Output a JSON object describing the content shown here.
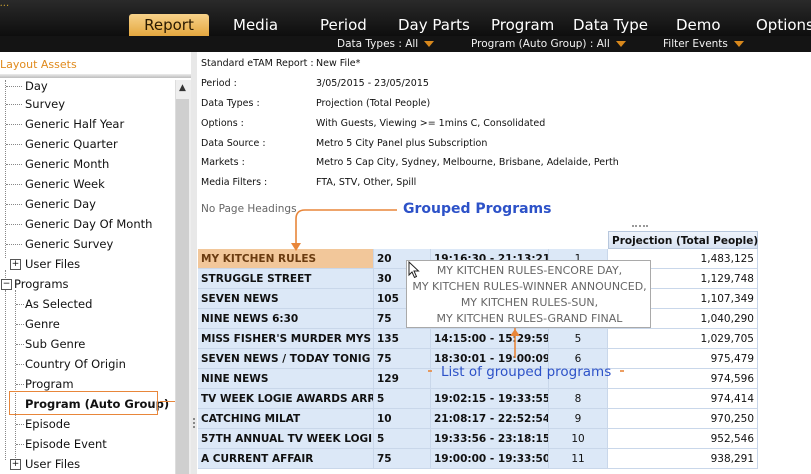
{
  "menu": {
    "brand": "...",
    "items": [
      {
        "label": "Report",
        "active": true
      },
      {
        "label": "Media"
      },
      {
        "label": "Period"
      },
      {
        "label": "Day Parts"
      },
      {
        "label": "Program"
      },
      {
        "label": "Data Type"
      },
      {
        "label": "Demo"
      },
      {
        "label": "Options"
      }
    ]
  },
  "subbar": {
    "data_types": "Data Types : All",
    "program": "Program (Auto Group) : All",
    "filter": "Filter Events"
  },
  "left_panel": {
    "title": "Layout Assets",
    "items": [
      {
        "label": "Day"
      },
      {
        "label": "Survey"
      },
      {
        "label": "Generic Half Year"
      },
      {
        "label": "Generic Quarter"
      },
      {
        "label": "Generic Month"
      },
      {
        "label": "Generic Week"
      },
      {
        "label": "Generic Day"
      },
      {
        "label": "Generic Day Of Month"
      },
      {
        "label": "Generic Survey"
      },
      {
        "label": "User Files"
      },
      {
        "label": "Programs"
      },
      {
        "label": "As Selected"
      },
      {
        "label": "Genre"
      },
      {
        "label": "Sub Genre"
      },
      {
        "label": "Country Of Origin"
      },
      {
        "label": "Program"
      },
      {
        "label": "Program (Auto Group)"
      },
      {
        "label": "Episode"
      },
      {
        "label": "Episode Event"
      },
      {
        "label": "User Files"
      }
    ]
  },
  "report_info": [
    {
      "label": "Standard eTAM Report :",
      "value": "New File*"
    },
    {
      "label": "Period :",
      "value": "3/05/2015 - 23/05/2015"
    },
    {
      "label": "Data Types :",
      "value": "Projection (Total People)"
    },
    {
      "label": "Options :",
      "value": "With Guests, Viewing >= 1mins C, Consolidated"
    },
    {
      "label": "Data Source :",
      "value": "Metro 5 City Panel plus Subscription"
    },
    {
      "label": "Markets :",
      "value": "Metro 5 Cap City, Sydney, Melbourne, Brisbane, Adelaide, Perth"
    },
    {
      "label": "Media Filters :",
      "value": "FTA, STV, Other, Spill"
    }
  ],
  "no_page_headings": "No Page Headings",
  "grid": {
    "projection_header": "Projection (Total People)",
    "rows": [
      {
        "program": "MY KITCHEN RULES",
        "num": "20",
        "time": "19:16:30 - 21:13:21",
        "ep": "1",
        "proj": "1,483,125"
      },
      {
        "program": "STRUGGLE STREET",
        "num": "30",
        "time": "",
        "ep": "",
        "proj": "1,129,748"
      },
      {
        "program": "SEVEN NEWS",
        "num": "105",
        "time": "",
        "ep": "",
        "proj": "1,107,349"
      },
      {
        "program": "NINE NEWS 6:30",
        "num": "75",
        "time": "",
        "ep": "",
        "proj": "1,040,290"
      },
      {
        "program": "MISS FISHER'S MURDER MYS",
        "num": "135",
        "time": "14:15:00 - 15:29:59",
        "ep": "5",
        "proj": "1,029,705"
      },
      {
        "program": "SEVEN NEWS / TODAY TONIG",
        "num": "75",
        "time": "18:30:01 - 19:00:09",
        "ep": "6",
        "proj": "975,479"
      },
      {
        "program": "NINE NEWS",
        "num": "129",
        "time": "",
        "ep": "",
        "proj": "974,596"
      },
      {
        "program": "TV WEEK LOGIE AWARDS ARR",
        "num": "5",
        "time": "19:02:15 - 19:33:55",
        "ep": "8",
        "proj": "974,414"
      },
      {
        "program": "CATCHING MILAT",
        "num": "10",
        "time": "21:08:17 - 22:52:54",
        "ep": "9",
        "proj": "970,250"
      },
      {
        "program": "57TH ANNUAL TV WEEK LOGI",
        "num": "5",
        "time": "19:33:56 - 23:18:15",
        "ep": "10",
        "proj": "952,546"
      },
      {
        "program": "A CURRENT AFFAIR",
        "num": "75",
        "time": "19:00:00 - 19:33:50",
        "ep": "11",
        "proj": "938,291"
      }
    ]
  },
  "tooltip": {
    "lines": [
      "MY KITCHEN RULES-ENCORE DAY,",
      "MY KITCHEN RULES-WINNER ANNOUNCED,",
      "MY KITCHEN RULES-SUN,",
      "MY KITCHEN RULES-GRAND FINAL"
    ]
  },
  "annotations": {
    "grouped_programs": "Grouped Programs",
    "list_grouped": "List of grouped programs",
    "color": "#e8863a",
    "text_color": "#2d52c8"
  }
}
